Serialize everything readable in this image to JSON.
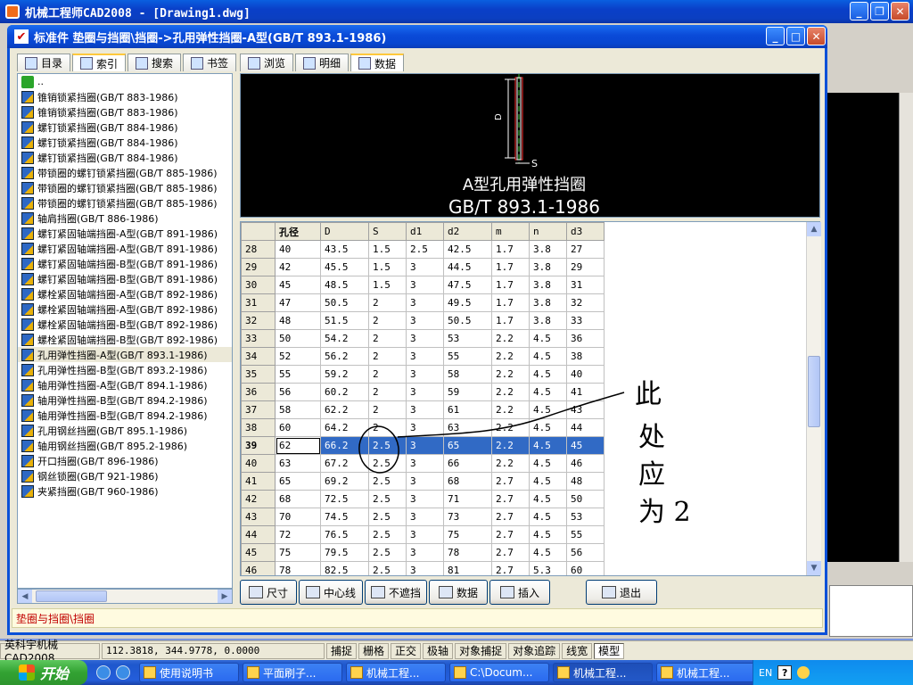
{
  "main_window": {
    "title": "机械工程师CAD2008 - [Drawing1.dwg]"
  },
  "dialog": {
    "title": "标准件 垫圈与挡圈\\挡圈->孔用弹性挡圈-A型(GB/T 893.1-1986)",
    "left_tabs": [
      "目录",
      "索引",
      "搜索",
      "书签"
    ],
    "right_tabs": [
      "浏览",
      "明细",
      "数据"
    ],
    "tree_items": [
      {
        "label": "..",
        "selected": false,
        "type": "up"
      },
      {
        "label": "锥销锁紧挡圈(GB/T 883-1986)",
        "selected": false
      },
      {
        "label": "锥销锁紧挡圈(GB/T 883-1986)",
        "selected": false
      },
      {
        "label": "螺钉锁紧挡圈(GB/T 884-1986)",
        "selected": false
      },
      {
        "label": "螺钉锁紧挡圈(GB/T 884-1986)",
        "selected": false
      },
      {
        "label": "螺钉锁紧挡圈(GB/T 884-1986)",
        "selected": false
      },
      {
        "label": "带锁圈的螺钉锁紧挡圈(GB/T 885-1986)",
        "selected": false
      },
      {
        "label": "带锁圈的螺钉锁紧挡圈(GB/T 885-1986)",
        "selected": false
      },
      {
        "label": "带锁圈的螺钉锁紧挡圈(GB/T 885-1986)",
        "selected": false
      },
      {
        "label": "轴肩挡圈(GB/T 886-1986)",
        "selected": false
      },
      {
        "label": "螺钉紧固轴端挡圈-A型(GB/T 891-1986)",
        "selected": false
      },
      {
        "label": "螺钉紧固轴端挡圈-A型(GB/T 891-1986)",
        "selected": false
      },
      {
        "label": "螺钉紧固轴端挡圈-B型(GB/T 891-1986)",
        "selected": false
      },
      {
        "label": "螺钉紧固轴端挡圈-B型(GB/T 891-1986)",
        "selected": false
      },
      {
        "label": "螺栓紧固轴端挡圈-A型(GB/T 892-1986)",
        "selected": false
      },
      {
        "label": "螺栓紧固轴端挡圈-A型(GB/T 892-1986)",
        "selected": false
      },
      {
        "label": "螺栓紧固轴端挡圈-B型(GB/T 892-1986)",
        "selected": false
      },
      {
        "label": "螺栓紧固轴端挡圈-B型(GB/T 892-1986)",
        "selected": false
      },
      {
        "label": "孔用弹性挡圈-A型(GB/T 893.1-1986)",
        "selected": true
      },
      {
        "label": "孔用弹性挡圈-B型(GB/T 893.2-1986)",
        "selected": false
      },
      {
        "label": "轴用弹性挡圈-A型(GB/T 894.1-1986)",
        "selected": false
      },
      {
        "label": "轴用弹性挡圈-B型(GB/T 894.2-1986)",
        "selected": false
      },
      {
        "label": "轴用弹性挡圈-B型(GB/T 894.2-1986)",
        "selected": false
      },
      {
        "label": "孔用钢丝挡圈(GB/T 895.1-1986)",
        "selected": false
      },
      {
        "label": "轴用钢丝挡圈(GB/T 895.2-1986)",
        "selected": false
      },
      {
        "label": "开口挡圈(GB/T 896-1986)",
        "selected": false
      },
      {
        "label": "钢丝锁圈(GB/T 921-1986)",
        "selected": false
      },
      {
        "label": "夹紧挡圈(GB/T 960-1986)",
        "selected": false
      }
    ],
    "preview": {
      "dim_D": "D",
      "dim_S": "S",
      "caption1": "A型孔用弹性挡圈",
      "caption2": "GB/T 893.1-1986"
    },
    "grid": {
      "columns": [
        "孔径",
        "D",
        "S",
        "d1",
        "d2",
        "m",
        "n",
        "d3"
      ],
      "selected_row": "39",
      "rows": [
        {
          "id": "28",
          "cells": [
            "40",
            "43.5",
            "1.5",
            "2.5",
            "42.5",
            "1.7",
            "3.8",
            "27"
          ]
        },
        {
          "id": "29",
          "cells": [
            "42",
            "45.5",
            "1.5",
            "3",
            "44.5",
            "1.7",
            "3.8",
            "29"
          ]
        },
        {
          "id": "30",
          "cells": [
            "45",
            "48.5",
            "1.5",
            "3",
            "47.5",
            "1.7",
            "3.8",
            "31"
          ]
        },
        {
          "id": "31",
          "cells": [
            "47",
            "50.5",
            "2",
            "3",
            "49.5",
            "1.7",
            "3.8",
            "32"
          ]
        },
        {
          "id": "32",
          "cells": [
            "48",
            "51.5",
            "2",
            "3",
            "50.5",
            "1.7",
            "3.8",
            "33"
          ]
        },
        {
          "id": "33",
          "cells": [
            "50",
            "54.2",
            "2",
            "3",
            "53",
            "2.2",
            "4.5",
            "36"
          ]
        },
        {
          "id": "34",
          "cells": [
            "52",
            "56.2",
            "2",
            "3",
            "55",
            "2.2",
            "4.5",
            "38"
          ]
        },
        {
          "id": "35",
          "cells": [
            "55",
            "59.2",
            "2",
            "3",
            "58",
            "2.2",
            "4.5",
            "40"
          ]
        },
        {
          "id": "36",
          "cells": [
            "56",
            "60.2",
            "2",
            "3",
            "59",
            "2.2",
            "4.5",
            "41"
          ]
        },
        {
          "id": "37",
          "cells": [
            "58",
            "62.2",
            "2",
            "3",
            "61",
            "2.2",
            "4.5",
            "43"
          ]
        },
        {
          "id": "38",
          "cells": [
            "60",
            "64.2",
            "2",
            "3",
            "63",
            "2.2",
            "4.5",
            "44"
          ]
        },
        {
          "id": "39",
          "cells": [
            "62",
            "66.2",
            "2.5",
            "3",
            "65",
            "2.2",
            "4.5",
            "45"
          ]
        },
        {
          "id": "40",
          "cells": [
            "63",
            "67.2",
            "2.5",
            "3",
            "66",
            "2.2",
            "4.5",
            "46"
          ]
        },
        {
          "id": "41",
          "cells": [
            "65",
            "69.2",
            "2.5",
            "3",
            "68",
            "2.7",
            "4.5",
            "48"
          ]
        },
        {
          "id": "42",
          "cells": [
            "68",
            "72.5",
            "2.5",
            "3",
            "71",
            "2.7",
            "4.5",
            "50"
          ]
        },
        {
          "id": "43",
          "cells": [
            "70",
            "74.5",
            "2.5",
            "3",
            "73",
            "2.7",
            "4.5",
            "53"
          ]
        },
        {
          "id": "44",
          "cells": [
            "72",
            "76.5",
            "2.5",
            "3",
            "75",
            "2.7",
            "4.5",
            "55"
          ]
        },
        {
          "id": "45",
          "cells": [
            "75",
            "79.5",
            "2.5",
            "3",
            "78",
            "2.7",
            "4.5",
            "56"
          ]
        },
        {
          "id": "46",
          "cells": [
            "78",
            "82.5",
            "2.5",
            "3",
            "81",
            "2.7",
            "5.3",
            "60"
          ]
        }
      ]
    },
    "buttons": {
      "size": "尺寸",
      "centerline": "中心线",
      "no_hide": "不遮挡",
      "data": "数据",
      "insert": "插入",
      "exit": "退出"
    },
    "status_path": "垫圈与挡圈\\挡圈"
  },
  "annotation": {
    "text": "此处应为 2",
    "line1": "此",
    "line2": "处",
    "line3": "应",
    "line4": "为 2"
  },
  "cad_status": {
    "brand": "英科宇机械CAD2008",
    "coords": "112.3818, 344.9778, 0.0000",
    "modes": [
      "捕捉",
      "栅格",
      "正交",
      "极轴",
      "对象捕捉",
      "对象追踪",
      "线宽",
      "模型"
    ]
  },
  "taskbar": {
    "start": "开始",
    "tasks": [
      "使用说明书",
      "平面刷子...",
      "机械工程...",
      "C:\\Docum...",
      "机械工程...",
      "机械工程..."
    ],
    "tray_lang": "EN",
    "tray_help": "?"
  }
}
